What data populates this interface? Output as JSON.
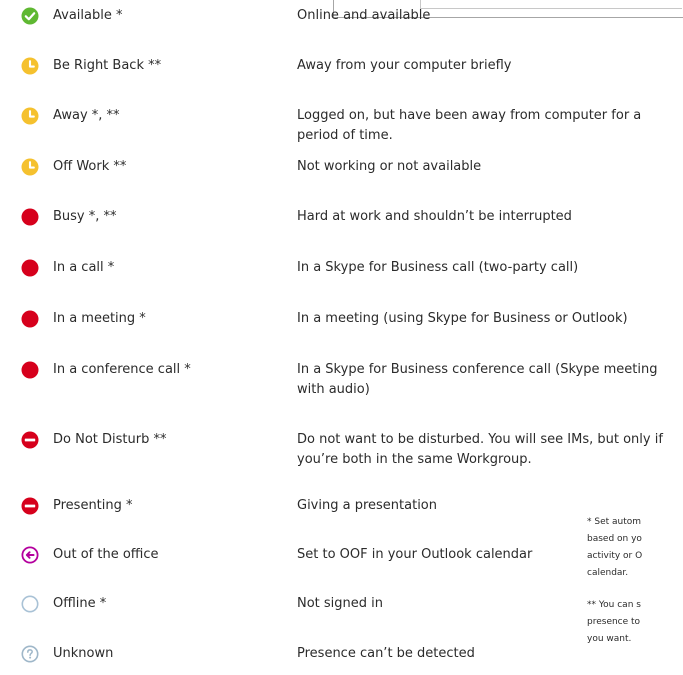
{
  "statuses": [
    {
      "name": "Available *",
      "description": "Online and available",
      "icon": "available-icon",
      "color": "#5fb832"
    },
    {
      "name": "Be Right Back **",
      "description": "Away from your computer briefly",
      "icon": "away-clock-icon",
      "color": "#f5c12e"
    },
    {
      "name": "Away *, **",
      "description": "Logged on, but have been away from computer for a period of time.",
      "icon": "away-clock-icon",
      "color": "#f5c12e"
    },
    {
      "name": "Off Work **",
      "description": "Not working or not available",
      "icon": "away-clock-icon",
      "color": "#f5c12e"
    },
    {
      "name": "Busy *, **",
      "description": "Hard at work and shouldn’t be interrupted",
      "icon": "busy-icon",
      "color": "#d6001c"
    },
    {
      "name": "In a call *",
      "description": "In a Skype for Business call (two-party call)",
      "icon": "busy-icon",
      "color": "#d6001c"
    },
    {
      "name": "In a meeting *",
      "description": "In a meeting (using Skype for Business or Outlook)",
      "icon": "busy-icon",
      "color": "#d6001c"
    },
    {
      "name": "In a conference call *",
      "description": "In a Skype for Business conference call (Skype meeting with audio)",
      "icon": "busy-icon",
      "color": "#d6001c"
    },
    {
      "name": "Do Not Disturb **",
      "description": "Do not want to be disturbed. You will see IMs, but only if you’re both in the same Workgroup.",
      "icon": "do-not-disturb-icon",
      "color": "#d6001c"
    },
    {
      "name": "Presenting *",
      "description": "Giving a presentation",
      "icon": "do-not-disturb-icon",
      "color": "#d6001c"
    },
    {
      "name": "Out of the office",
      "description": "Set to OOF in your Outlook calendar",
      "icon": "out-of-office-icon",
      "color": "#b4009e"
    },
    {
      "name": "Offline *",
      "description": "Not signed in",
      "icon": "offline-icon",
      "color": "#a9c2d6"
    },
    {
      "name": "Unknown",
      "description": "Presence can’t be detected",
      "icon": "unknown-icon",
      "color": "#9fb7c9"
    }
  ],
  "footnotes": [
    {
      "lines": [
        "* Set autom",
        "based on yo",
        "activity or O",
        "calendar."
      ]
    },
    {
      "lines": [
        "** You can s",
        "presence to",
        "you want."
      ]
    }
  ]
}
